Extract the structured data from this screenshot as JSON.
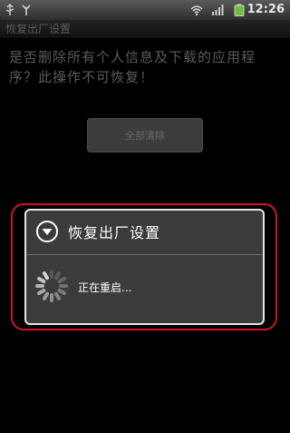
{
  "status_bar": {
    "time": "12:26",
    "icons": [
      "usb-icon",
      "antenna-icon",
      "wifi-icon",
      "signal-icon",
      "battery-icon"
    ]
  },
  "background": {
    "title": "恢复出厂设置",
    "message": "是否删除所有个人信息及下载的应用程序？此操作不可恢复！",
    "button_label": "全部清除"
  },
  "dialog": {
    "title": "恢复出厂设置",
    "message": "正在重启...",
    "icon": "chevron-down-circle-icon"
  },
  "colors": {
    "highlight": "#d0151f",
    "dialog_bg": "#3b3b3b",
    "dialog_border": "#e6e6e6"
  }
}
